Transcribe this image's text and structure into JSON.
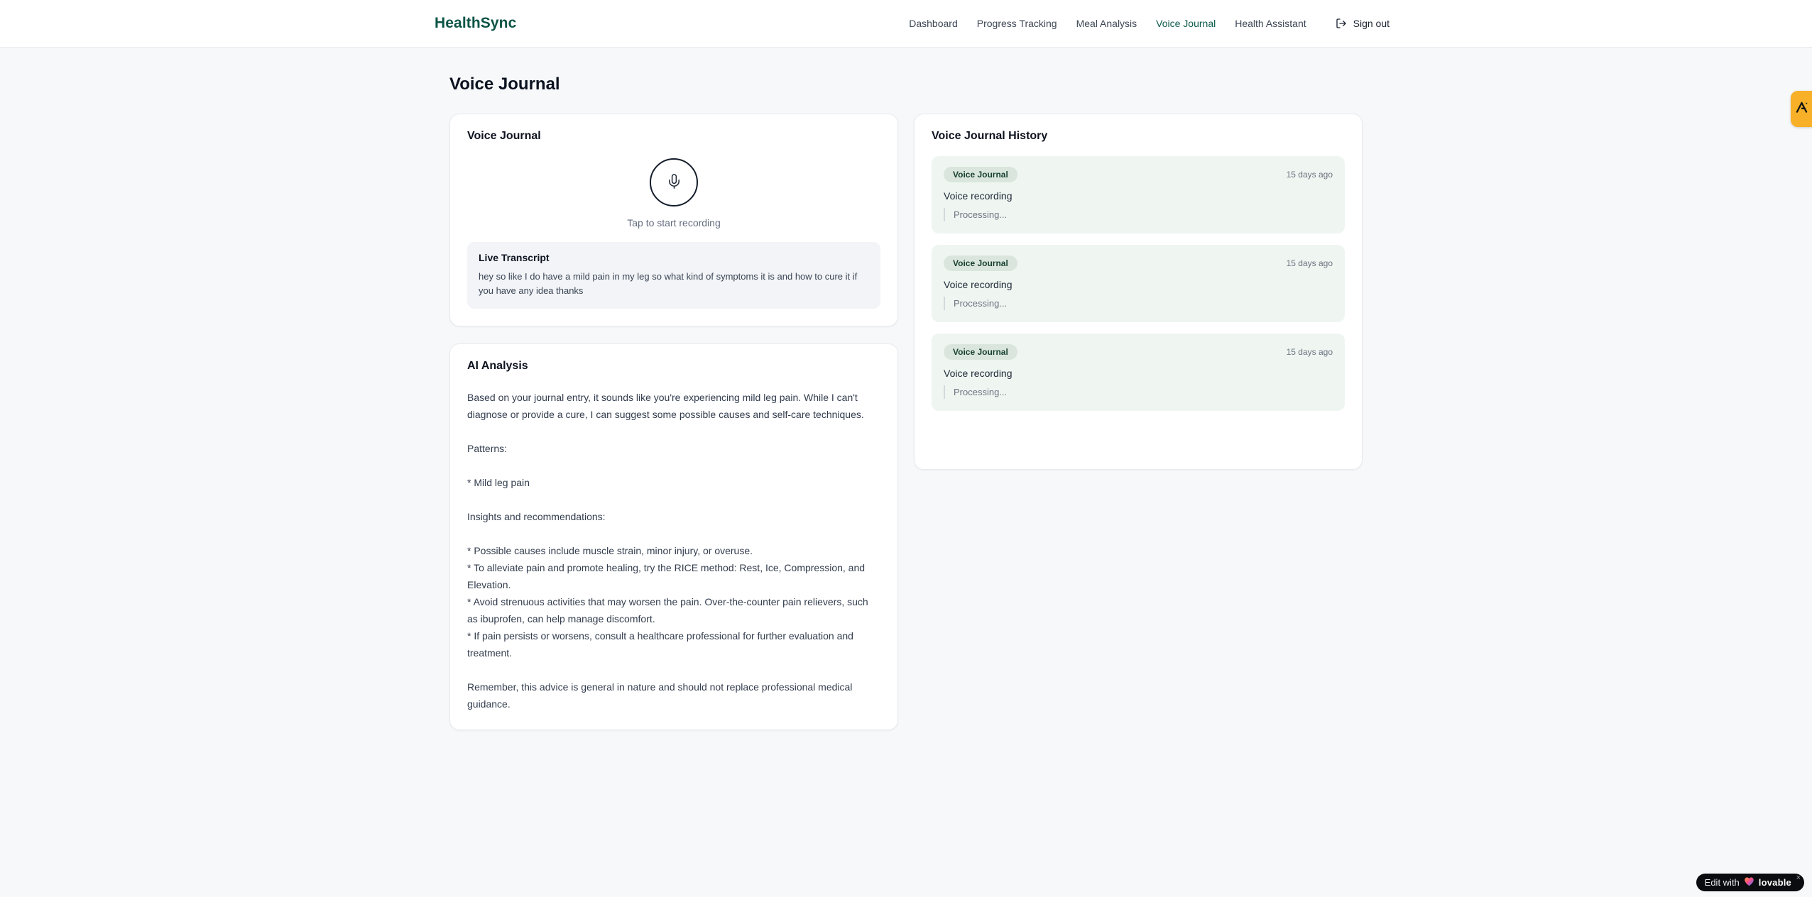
{
  "header": {
    "brand": "HealthSync",
    "nav_items": [
      {
        "label": "Dashboard",
        "active": false
      },
      {
        "label": "Progress Tracking",
        "active": false
      },
      {
        "label": "Meal Analysis",
        "active": false
      },
      {
        "label": "Voice Journal",
        "active": true
      },
      {
        "label": "Health Assistant",
        "active": false
      }
    ],
    "sign_out_label": "Sign out"
  },
  "page": {
    "title": "Voice Journal"
  },
  "recorder_card": {
    "title": "Voice Journal",
    "tap_hint": "Tap to start recording",
    "live_transcript": {
      "title": "Live Transcript",
      "text": "hey so like I do have a mild pain in my leg so what kind of symptoms it is and how to cure it if you have any idea thanks"
    }
  },
  "analysis_card": {
    "title": "AI Analysis",
    "body": "Based on your journal entry, it sounds like you're experiencing mild leg pain. While I can't diagnose or provide a cure, I can suggest some possible causes and self-care techniques.\n\nPatterns:\n\n* Mild leg pain\n\nInsights and recommendations:\n\n* Possible causes include muscle strain, minor injury, or overuse.\n* To alleviate pain and promote healing, try the RICE method: Rest, Ice, Compression, and Elevation.\n* Avoid strenuous activities that may worsen the pain. Over-the-counter pain relievers, such as ibuprofen, can help manage discomfort.\n* If pain persists or worsens, consult a healthcare professional for further evaluation and treatment.\n\nRemember, this advice is general in nature and should not replace professional medical guidance."
  },
  "history_card": {
    "title": "Voice Journal History",
    "items": [
      {
        "badge": "Voice Journal",
        "time": "15 days ago",
        "label": "Voice recording",
        "status": "Processing..."
      },
      {
        "badge": "Voice Journal",
        "time": "15 days ago",
        "label": "Voice recording",
        "status": "Processing..."
      },
      {
        "badge": "Voice Journal",
        "time": "15 days ago",
        "label": "Voice recording",
        "status": "Processing..."
      }
    ]
  },
  "overlays": {
    "lovable_badge": {
      "prefix": "Edit with",
      "brand": "lovable",
      "close": "×"
    }
  },
  "colors": {
    "brand_teal": "#0c5446",
    "active_nav": "#0c5a4b",
    "page_bg": "#f7f8fa",
    "history_item_bg": "#eff6f1",
    "badge_bg": "#dae6dd",
    "badge_text": "#173f31",
    "side_badge_amber": "#f7b027",
    "lovable_bg": "#0b0c0f"
  }
}
